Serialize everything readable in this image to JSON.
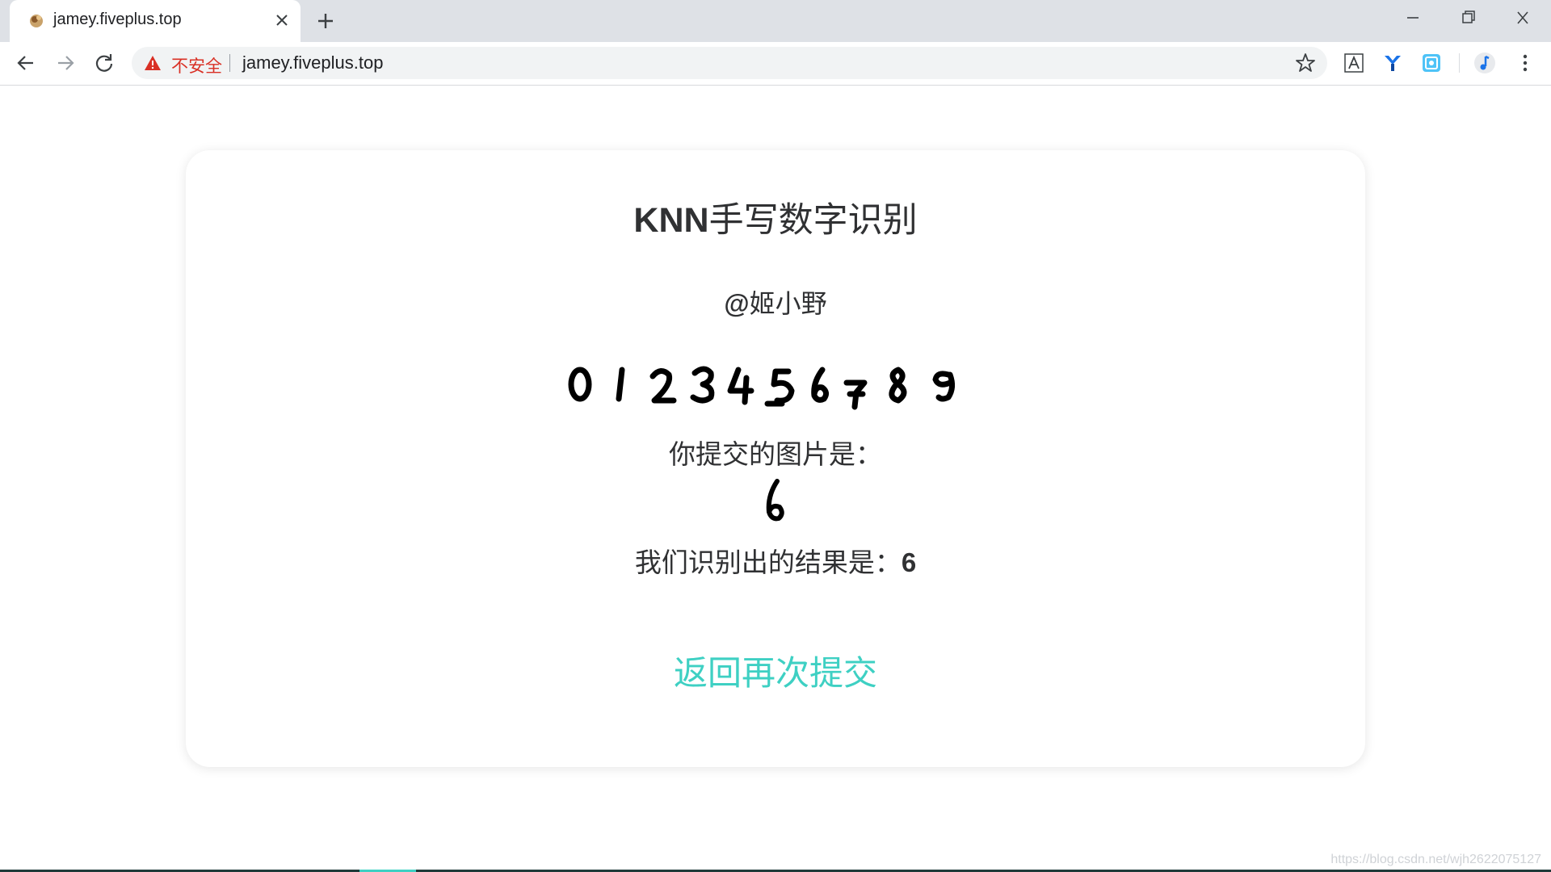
{
  "browser": {
    "tab_title": "jamey.fiveplus.top",
    "security_label": "不安全",
    "url": "jamey.fiveplus.top"
  },
  "page": {
    "title_bold": "KNN",
    "title_rest": "手写数字识别",
    "author_at": "@",
    "author_name": "姬小野",
    "sample_digits": [
      "0",
      "1",
      "2",
      "3",
      "4",
      "5",
      "6",
      "7",
      "8",
      "9"
    ],
    "submitted_label": "你提交的图片是：",
    "submitted_digit": "6",
    "result_label": "我们识别出的结果是：",
    "result_value": "6",
    "back_link": "返回再次提交"
  },
  "watermark": "https://blog.csdn.net/wjh2622075127",
  "colors": {
    "accent": "#3ed0c3",
    "text": "#303133",
    "warning": "#d93025"
  },
  "icons": [
    "favicon-icon",
    "close-icon",
    "plus-icon",
    "minimize-icon",
    "restore-icon",
    "window-close-icon",
    "back-arrow-icon",
    "forward-arrow-icon",
    "reload-icon",
    "warning-icon",
    "star-icon",
    "translate-extension-icon",
    "y-extension-icon",
    "screenshot-extension-icon",
    "profile-avatar-icon",
    "more-menu-icon"
  ]
}
